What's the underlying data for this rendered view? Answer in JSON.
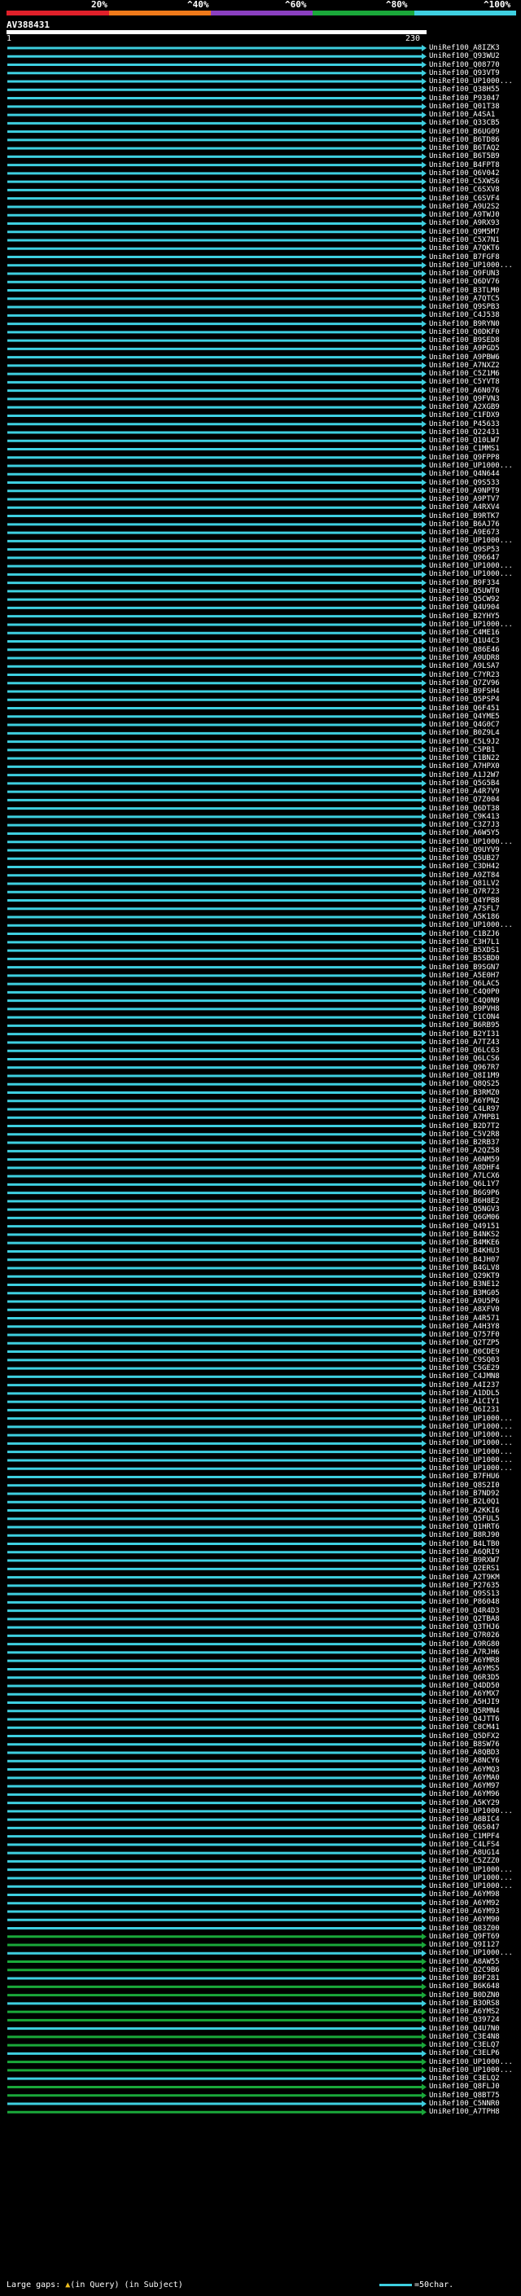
{
  "legend": {
    "labels": [
      "20%",
      "^40%",
      "^60%",
      "^80%",
      "^100%"
    ],
    "colors": [
      "#e0202a",
      "#f07a1a",
      "#8a3fc0",
      "#1aa83a",
      "#3ecfe0"
    ]
  },
  "query": {
    "id": "AV388431",
    "start": "1",
    "end": "230"
  },
  "hits": [
    "UniRef100_A8IZK3",
    "UniRef100_Q93WU2",
    "UniRef100_Q08770",
    "UniRef100_Q93VT9",
    "UniRef100_UP1000...",
    "UniRef100_Q38H55",
    "UniRef100_P93047",
    "UniRef100_Q01T38",
    "UniRef100_A4SA1",
    "UniRef100_Q33CB5",
    "UniRef100_B6UG09",
    "UniRef100_B6TD86",
    "UniRef100_B6TAQ2",
    "UniRef100_B6T5B9",
    "UniRef100_B4FPT8",
    "UniRef100_Q6V042",
    "UniRef100_C5XWS6",
    "UniRef100_C6SXV8",
    "UniRef100_C6SVF4",
    "UniRef100_A9U2S2",
    "UniRef100_A9TWJ0",
    "UniRef100_A9RX93",
    "UniRef100_Q9M5M7",
    "UniRef100_C5X7N1",
    "UniRef100_A7QKT6",
    "UniRef100_B7FGF8",
    "UniRef100_UP1000...",
    "UniRef100_Q9FUN3",
    "UniRef100_Q6DV76",
    "UniRef100_B3TLM0",
    "UniRef100_A7QTC5",
    "UniRef100_Q9SPB3",
    "UniRef100_C4J538",
    "UniRef100_B9RYN0",
    "UniRef100_Q0DKF0",
    "UniRef100_B9SED8",
    "UniRef100_A9PGD5",
    "UniRef100_A9PBW6",
    "UniRef100_A7NXZ2",
    "UniRef100_C5Z1M6",
    "UniRef100_C5YVT8",
    "UniRef100_A6N076",
    "UniRef100_Q9FVN3",
    "UniRef100_A2XGB9",
    "UniRef100_C1FDX9",
    "UniRef100_P45633",
    "UniRef100_Q22431",
    "UniRef100_Q10LW7",
    "UniRef100_C1MMS1",
    "UniRef100_Q9FPP8",
    "UniRef100_UP1000...",
    "UniRef100_Q4N644",
    "UniRef100_Q9S533",
    "UniRef100_A9NPT9",
    "UniRef100_A9PTV7",
    "UniRef100_A4RXV4",
    "UniRef100_B9RTK7",
    "UniRef100_B6AJ76",
    "UniRef100_A9E673",
    "UniRef100_UP1000...",
    "UniRef100_Q9SP53",
    "UniRef100_Q96647",
    "UniRef100_UP1000...",
    "UniRef100_UP1000...",
    "UniRef100_B9F334",
    "UniRef100_Q5UWT0",
    "UniRef100_Q5CW92",
    "UniRef100_Q4U904",
    "UniRef100_B2YHY5",
    "UniRef100_UP1000...",
    "UniRef100_C4ME16",
    "UniRef100_Q1U4C3",
    "UniRef100_Q86E46",
    "UniRef100_A9UDR8",
    "UniRef100_A9LSA7",
    "UniRef100_C7YR23",
    "UniRef100_Q7ZV96",
    "UniRef100_B9FSH4",
    "UniRef100_Q5PSP4",
    "UniRef100_Q6F451",
    "UniRef100_Q4YME5",
    "UniRef100_Q4G0C7",
    "UniRef100_B0Z9L4",
    "UniRef100_C5L9J2",
    "UniRef100_C5PB1",
    "UniRef100_C1BN22",
    "UniRef100_A7HPX0",
    "UniRef100_A1J2W7",
    "UniRef100_Q5G5B4",
    "UniRef100_A4R7V9",
    "UniRef100_Q7Z004",
    "UniRef100_Q6DT38",
    "UniRef100_C9K413",
    "UniRef100_C3Z7J3",
    "UniRef100_A6W5Y5",
    "UniRef100_UP1000...",
    "UniRef100_Q9UYV9",
    "UniRef100_Q5UB27",
    "UniRef100_C3DH42",
    "UniRef100_A9ZT84",
    "UniRef100_Q81LV2",
    "UniRef100_Q7R723",
    "UniRef100_Q4YPB8",
    "UniRef100_A7SFL7",
    "UniRef100_A5K186",
    "UniRef100_UP1000...",
    "UniRef100_C1BZJ6",
    "UniRef100_C3H7L1",
    "UniRef100_B5XDS1",
    "UniRef100_B5SBD0",
    "UniRef100_B9SGN7",
    "UniRef100_A5E0H7",
    "UniRef100_Q6LAC5",
    "UniRef100_C4Q0P0",
    "UniRef100_C4Q0N9",
    "UniRef100_B9PVH8",
    "UniRef100_C1CON4",
    "UniRef100_B6RB95",
    "UniRef100_B2YI31",
    "UniRef100_A7TZ43",
    "UniRef100_Q6LC63",
    "UniRef100_Q6LCS6",
    "UniRef100_Q967R7",
    "UniRef100_Q8I1M9",
    "UniRef100_Q8QS25",
    "UniRef100_B3RMZ0",
    "UniRef100_A6YPN2",
    "UniRef100_C4LR97",
    "UniRef100_A7MPB1",
    "UniRef100_B2D7T2",
    "UniRef100_C5V2R8",
    "UniRef100_B2RB37",
    "UniRef100_A2QZ58",
    "UniRef100_A6NM59",
    "UniRef100_A8DHF4",
    "UniRef100_A7LCX6",
    "UniRef100_Q6L1Y7",
    "UniRef100_B6G9P6",
    "UniRef100_B6H8E2",
    "UniRef100_Q5NGV3",
    "UniRef100_Q6GM06",
    "UniRef100_Q49151",
    "UniRef100_B4NKS2",
    "UniRef100_B4MKE6",
    "UniRef100_B4KHU3",
    "UniRef100_B4JH07",
    "UniRef100_B4GLV8",
    "UniRef100_Q29KT9",
    "UniRef100_B3NE12",
    "UniRef100_B3MG05",
    "UniRef100_A9U5P6",
    "UniRef100_A8XFV0",
    "UniRef100_A4R571",
    "UniRef100_A4H3Y8",
    "UniRef100_Q757F0",
    "UniRef100_Q2TZP5",
    "UniRef100_Q0CDE9",
    "UniRef100_C9SQ03",
    "UniRef100_C5GE29",
    "UniRef100_C4JMN8",
    "UniRef100_A4I237",
    "UniRef100_A1DDL5",
    "UniRef100_A1CIY1",
    "UniRef100_Q6I231",
    "UniRef100_UP1000...",
    "UniRef100_UP1000...",
    "UniRef100_UP1000...",
    "UniRef100_UP1000...",
    "UniRef100_UP1000...",
    "UniRef100_UP1000...",
    "UniRef100_UP1000...",
    "UniRef100_B7FHU6",
    "UniRef100_Q8S2I0",
    "UniRef100_B7ND92",
    "UniRef100_B2L0Q1",
    "UniRef100_A2KKI6",
    "UniRef100_Q5FUL5",
    "UniRef100_Q1HRT6",
    "UniRef100_B8RJ90",
    "UniRef100_B4LTB0",
    "UniRef100_A6QRI9",
    "UniRef100_B9RXW7",
    "UniRef100_Q2ERS1",
    "UniRef100_A2T9KM",
    "UniRef100_P27635",
    "UniRef100_Q9SS13",
    "UniRef100_P86048",
    "UniRef100_Q4R4D3",
    "UniRef100_Q2TBA8",
    "UniRef100_Q3THJ6",
    "UniRef100_Q7R026",
    "UniRef100_A9RG80",
    "UniRef100_A7RJH6",
    "UniRef100_A6YMR8",
    "UniRef100_A6YMS5",
    "UniRef100_Q6R3D5",
    "UniRef100_Q4DD50",
    "UniRef100_A6YMX7",
    "UniRef100_A5HJI9",
    "UniRef100_Q5RMN4",
    "UniRef100_Q4JTT6",
    "UniRef100_C8CM41",
    "UniRef100_Q5DFX2",
    "UniRef100_B8SW76",
    "UniRef100_A8QBD3",
    "UniRef100_A8NCY6",
    "UniRef100_A6YMQ3",
    "UniRef100_A6YMA0",
    "UniRef100_A6YM97",
    "UniRef100_A6YM96",
    "UniRef100_A5KY29",
    "UniRef100_UP1000...",
    "UniRef100_A8BIC4",
    "UniRef100_Q6S047",
    "UniRef100_C1MPF4",
    "UniRef100_C4LFS4",
    "UniRef100_A8UG14",
    "UniRef100_C5ZZZ0",
    "UniRef100_UP1000...",
    "UniRef100_UP1000...",
    "UniRef100_UP1000...",
    "UniRef100_A6YM98",
    "UniRef100_A6YM92",
    "UniRef100_A6YM93",
    "UniRef100_A6YM90",
    "UniRef100_Q83Z00",
    "UniRef100_Q9FT69",
    "UniRef100_Q9I127",
    "UniRef100_UP1000...",
    "UniRef100_A8AW55",
    "UniRef100_Q2C9B6",
    "UniRef100_B9F281",
    "UniRef100_B6K648",
    "UniRef100_B0DZN0",
    "UniRef100_B3ORS8",
    "UniRef100_A6YMS2",
    "UniRef100_Q39724",
    "UniRef100_Q4U7N0",
    "UniRef100_C3E4N8",
    "UniRef100_C3ELQ7",
    "UniRef100_C3ELP6",
    "UniRef100_UP1000...",
    "UniRef100_UP1000...",
    "UniRef100_C3ELQ2",
    "UniRef100_Q8FLJ0",
    "UniRef100_Q8BT75",
    "UniRef100_C5NNR0",
    "UniRef100_A7TPH8"
  ],
  "footer": {
    "large_gaps": "Large gaps:",
    "gap_query": "(in Query)",
    "gap_subject": "(in Subject)",
    "scale": "=50char."
  }
}
